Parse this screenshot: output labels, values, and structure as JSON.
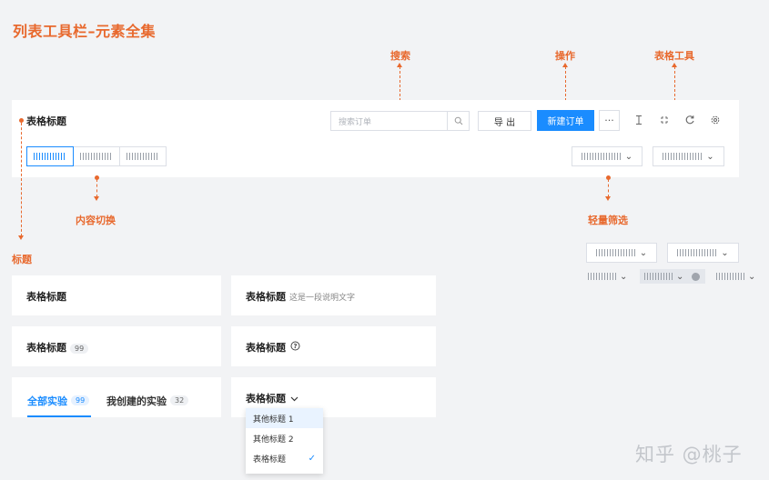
{
  "page_title": "列表工具栏–元素全集",
  "annotations": {
    "search": "搜索",
    "actions": "操作",
    "table_tools": "表格工具",
    "content_switch": "内容切换",
    "light_filter": "轻量筛选",
    "title": "标题"
  },
  "toolbar": {
    "title": "表格标题",
    "search_placeholder": "搜索订单",
    "export_label": "导 出",
    "new_order_label": "新建订单",
    "more_label": "···"
  },
  "card1": {
    "title": "表格标题"
  },
  "card2": {
    "title": "表格标题",
    "desc": "这是一段说明文字"
  },
  "card3": {
    "title": "表格标题",
    "badge": "99"
  },
  "card4": {
    "title": "表格标题"
  },
  "card5": {
    "tabs": [
      {
        "label": "全部实验",
        "badge": "99"
      },
      {
        "label": "我创建的实验",
        "badge": "32"
      }
    ]
  },
  "card6": {
    "title": "表格标题"
  },
  "menu": {
    "items": [
      {
        "label": "其他标题 1"
      },
      {
        "label": "其他标题 2"
      },
      {
        "label": "表格标题"
      }
    ]
  },
  "watermark": "知乎 @桃子",
  "colors": {
    "accent": "#e8692e",
    "primary": "#1a8cff"
  },
  "icons": [
    "search-icon",
    "column-height-icon",
    "fullscreen-icon",
    "reload-icon",
    "settings-icon",
    "chevron-down-icon",
    "question-icon",
    "check-icon",
    "close-circle-icon"
  ]
}
